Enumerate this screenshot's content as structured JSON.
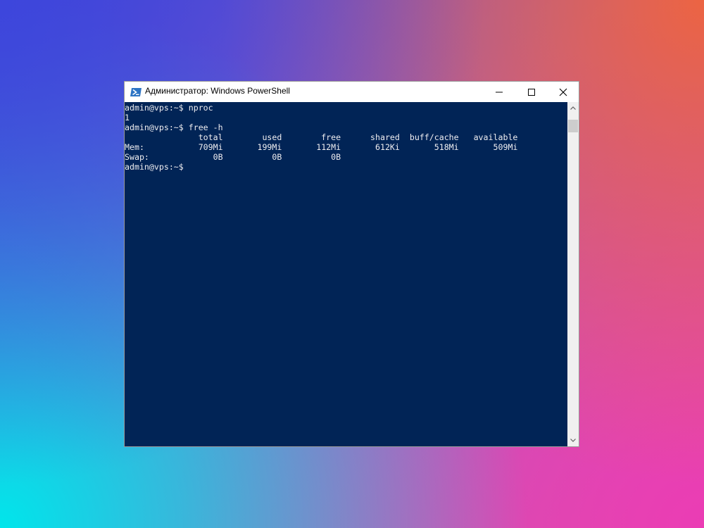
{
  "window": {
    "title": "Администратор: Windows PowerShell",
    "icons": {
      "app": "powershell-icon",
      "minimize": "minimize-icon",
      "maximize": "maximize-icon",
      "close": "close-icon"
    }
  },
  "console": {
    "background": "#012456",
    "foreground": "#eeedf0",
    "lines": [
      "admin@vps:~$ nproc",
      "1",
      "admin@vps:~$ free -h",
      "               total        used        free      shared  buff/cache   available",
      "Mem:           709Mi       199Mi       112Mi       612Ki       518Mi       509Mi",
      "Swap:             0B          0B          0B",
      "admin@vps:~$"
    ]
  },
  "scrollbar": {
    "up": "scroll-up-arrow-icon",
    "down": "scroll-down-arrow-icon"
  }
}
